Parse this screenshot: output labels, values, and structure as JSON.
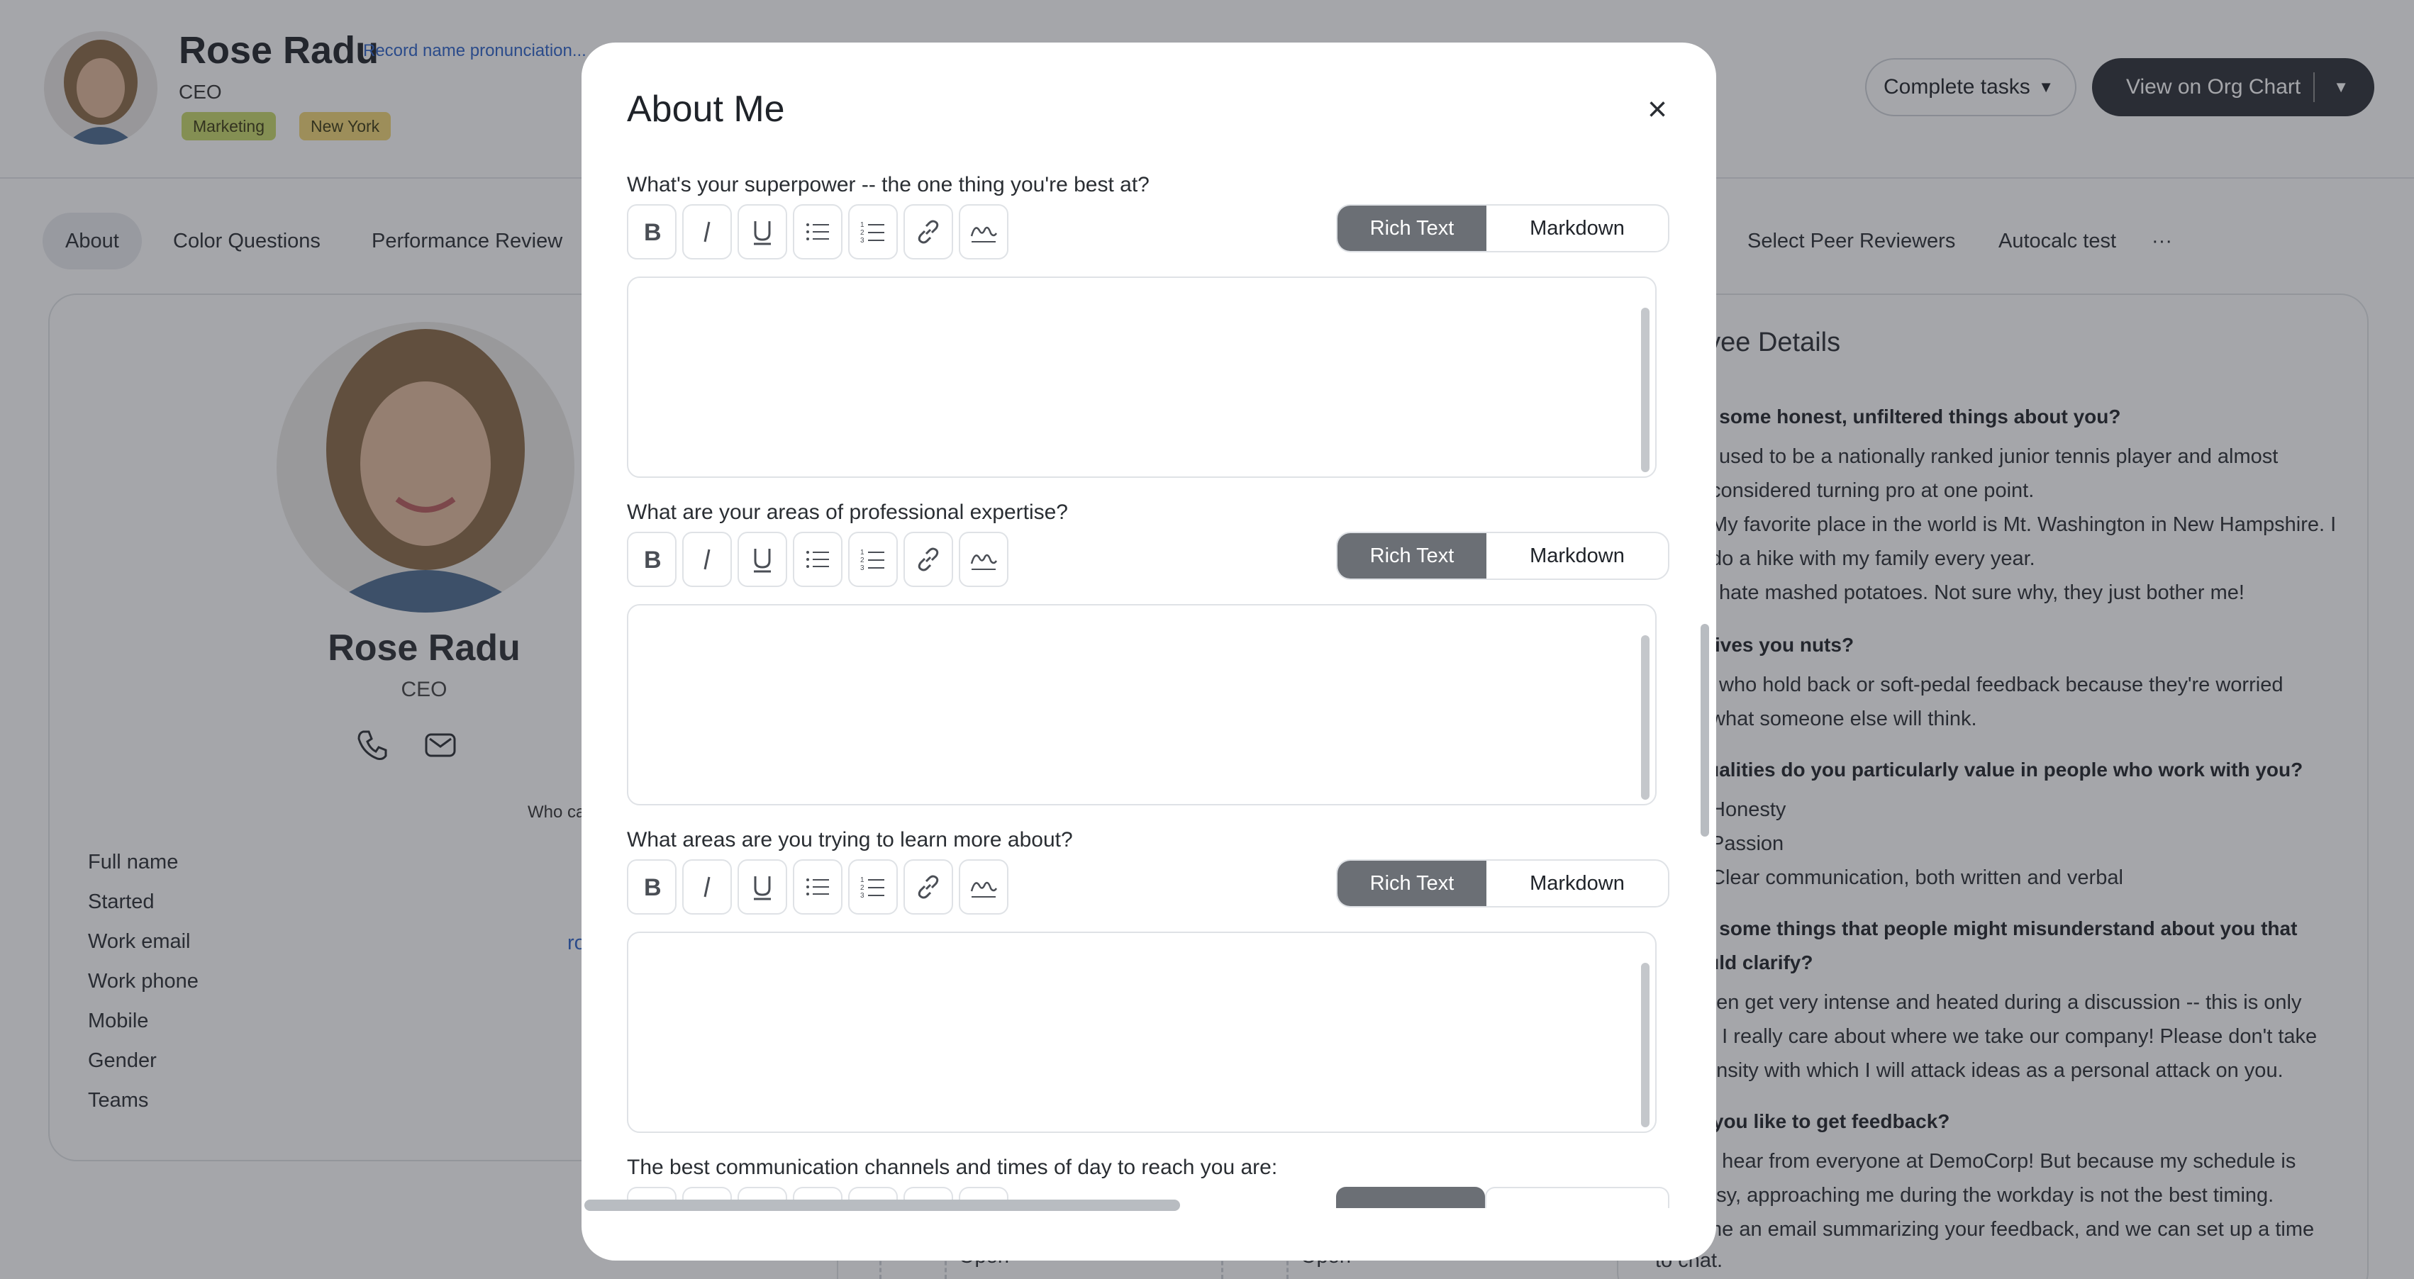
{
  "header": {
    "name": "Rose Radu",
    "pronunciation_link": "Record name pronunciation...",
    "title": "CEO",
    "tags": [
      "Marketing",
      "New York"
    ],
    "complete_tasks": "Complete tasks",
    "view_org_chart": "View on Org Chart"
  },
  "tabs": [
    "About",
    "Color Questions",
    "Performance Review",
    "Select Peer Reviewers",
    "Autocalc test",
    "···"
  ],
  "profile": {
    "name": "Rose Radu",
    "title": "CEO",
    "who_fragment": "Who ca",
    "fields": [
      "Full name",
      "Started",
      "Work email",
      "Work phone",
      "Mobile",
      "Gender",
      "Teams"
    ],
    "email_fragment": "ro"
  },
  "details": {
    "title_fragment": "oyee Details",
    "items": [
      {
        "q": "re some honest, unfiltered things about you?",
        "a": [
          "used to be a nationally ranked junior tennis player and almost",
          "considered turning pro at one point.",
          "My favorite place in the world is Mt. Washington in New Hampshire. I",
          "do a hike with my family every year.",
          "hate mashed potatoes. Not sure why, they just bother me!"
        ]
      },
      {
        "q": "drives you nuts?",
        "a": [
          "who hold back or soft-pedal feedback because they're worried",
          "what someone else will think."
        ]
      },
      {
        "q": "qualities do you particularly value in people who work with you?",
        "a": [
          "Honesty",
          "Passion",
          "Clear communication, both written and verbal"
        ]
      },
      {
        "q": "re some things that people might misunderstand about you that",
        "q2": "ould clarify?",
        "a": [
          "ften get very intense and heated during a discussion -- this is only",
          "e I really care about where we take our company! Please don't take",
          "ensity with which I will attack ideas as a personal attack on you."
        ]
      },
      {
        "q": "o you like to get feedback?",
        "a": [
          "o hear from everyone at DemoCorp! But because my schedule is",
          "usy, approaching me during the workday is not the best timing.",
          "me an email summarizing your feedback, and we can set up a time",
          "to chat."
        ]
      }
    ]
  },
  "bottom": {
    "open_1": "Open",
    "open_2": "Open"
  },
  "modal": {
    "title": "About Me",
    "close": "×",
    "rich_text": "Rich Text",
    "markdown": "Markdown",
    "questions": [
      "What's your superpower -- the one thing you're best at?",
      "What are your areas of professional expertise?",
      "What areas are you trying to learn more about?",
      "The best communication channels and times of day to reach you are:"
    ]
  },
  "colors": {
    "accent_dark": "#2b2f36",
    "segment_active": "#6b6f75",
    "link_blue": "#2d63c8",
    "tag_marketing": "#c6d76a",
    "tag_newyork": "#f2d675"
  },
  "icons": [
    "bold-icon",
    "italic-icon",
    "underline-icon",
    "bulleted-list-icon",
    "numbered-list-icon",
    "link-icon",
    "signature-icon",
    "close-icon",
    "phone-icon",
    "mail-icon",
    "caret-down-icon"
  ]
}
